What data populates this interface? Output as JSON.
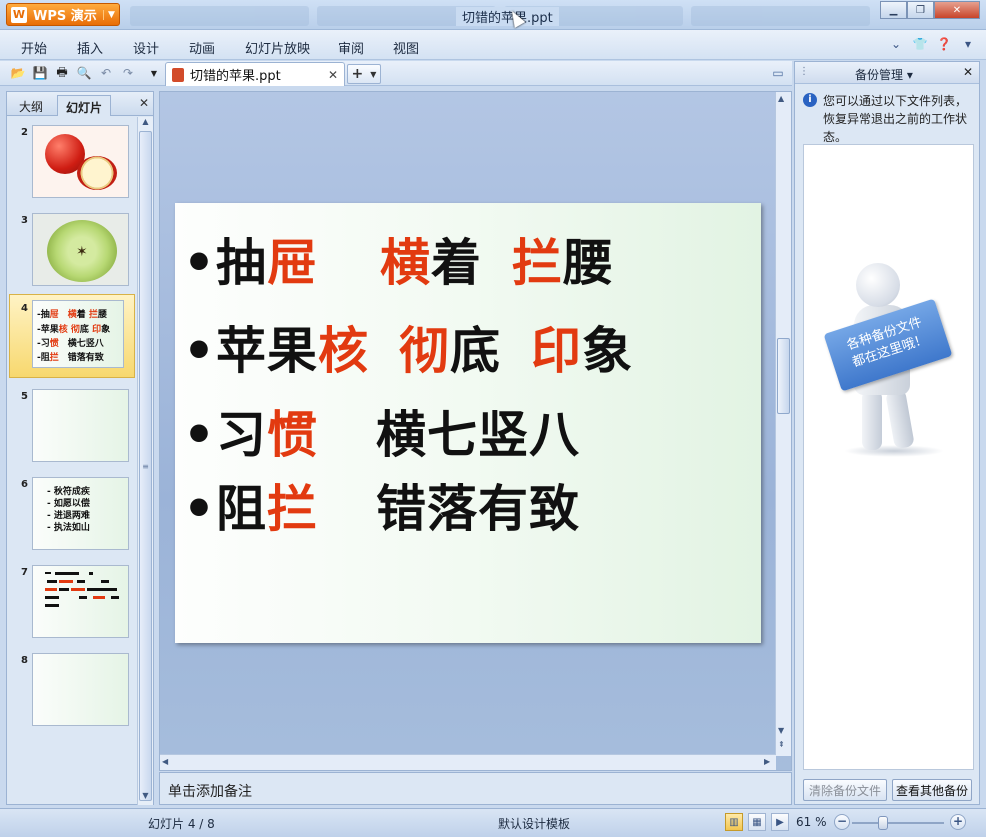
{
  "app": {
    "button_label": "WPS 演示",
    "logo_letter": "W",
    "title": "切错的苹果.ppt"
  },
  "menu": {
    "items": [
      "开始",
      "插入",
      "设计",
      "动画",
      "幻灯片放映",
      "审阅",
      "视图"
    ]
  },
  "toolbar": {
    "doc_tab_label": "切错的苹果.ppt",
    "new_tab_label": "+"
  },
  "left_panel": {
    "tab_outline": "大纲",
    "tab_slides": "幻灯片",
    "thumbnails": [
      {
        "number": "2",
        "kind": "apple-photo"
      },
      {
        "number": "3",
        "kind": "apple-slice"
      },
      {
        "number": "4",
        "kind": "text",
        "selected": true,
        "lines": [
          [
            {
              "t": "-抽",
              "r": false
            },
            {
              "t": "屉",
              "r": true
            },
            {
              "t": "　",
              "r": false
            },
            {
              "t": "横",
              "r": true
            },
            {
              "t": "着 ",
              "r": false
            },
            {
              "t": "拦",
              "r": true
            },
            {
              "t": "腰",
              "r": false
            }
          ],
          [
            {
              "t": "-苹果",
              "r": false
            },
            {
              "t": "核",
              "r": true
            },
            {
              "t": " ",
              "r": false
            },
            {
              "t": "彻",
              "r": true
            },
            {
              "t": "底 ",
              "r": false
            },
            {
              "t": "印",
              "r": true
            },
            {
              "t": "象",
              "r": false
            }
          ],
          [
            {
              "t": "-习",
              "r": false
            },
            {
              "t": "惯",
              "r": true
            },
            {
              "t": "　横七竖八",
              "r": false
            }
          ],
          [
            {
              "t": "-阻",
              "r": false
            },
            {
              "t": "拦",
              "r": true
            },
            {
              "t": "　错落有致",
              "r": false
            }
          ]
        ]
      },
      {
        "number": "5",
        "kind": "blank"
      },
      {
        "number": "6",
        "kind": "text",
        "lines": [
          [
            {
              "t": "- 秋符成疾",
              "r": false
            }
          ],
          [
            {
              "t": "- 如愿以偿",
              "r": false
            }
          ],
          [
            {
              "t": "- 进退两难",
              "r": false
            }
          ],
          [
            {
              "t": "- 执法如山",
              "r": false
            }
          ]
        ]
      },
      {
        "number": "7",
        "kind": "text-small"
      },
      {
        "number": "8",
        "kind": "blank"
      }
    ]
  },
  "slide": {
    "lines": [
      [
        {
          "t": "•抽",
          "r": false
        },
        {
          "t": "屉",
          "r": true
        },
        {
          "t": "GAP1",
          "r": false
        },
        {
          "t": "横",
          "r": true
        },
        {
          "t": "着",
          "r": false
        },
        {
          "t": "GAP2",
          "r": false
        },
        {
          "t": "拦",
          "r": true
        },
        {
          "t": "腰",
          "r": false
        }
      ],
      [
        {
          "t": "•苹果",
          "r": false
        },
        {
          "t": "核",
          "r": true
        },
        {
          "t": "GAP2",
          "r": false
        },
        {
          "t": "彻",
          "r": true
        },
        {
          "t": "底",
          "r": false
        },
        {
          "t": "GAP2",
          "r": false
        },
        {
          "t": "印",
          "r": true
        },
        {
          "t": "象",
          "r": false
        }
      ],
      [
        {
          "t": "•习",
          "r": false
        },
        {
          "t": "惯",
          "r": true
        },
        {
          "t": "GAP3",
          "r": false
        },
        {
          "t": "横七竖八",
          "r": false
        }
      ],
      [
        {
          "t": "•阻",
          "r": false
        },
        {
          "t": "拦",
          "r": true
        },
        {
          "t": "GAP3",
          "r": false
        },
        {
          "t": "错落有致",
          "r": false
        }
      ]
    ]
  },
  "notes": {
    "placeholder": "单击添加备注"
  },
  "right_pane": {
    "title": "备份管理",
    "info": "您可以通过以下文件列表，恢复异常退出之前的工作状态。",
    "sign_line1": "各种备份文件",
    "sign_line2": "都在这里哦！",
    "btn_clear": "清除备份文件",
    "btn_view": "查看其他备份"
  },
  "status": {
    "slide_indicator": "幻灯片 4 / 8",
    "template": "默认设计模板",
    "zoom": "61 %",
    "zoom_level": 0.61
  },
  "colors": {
    "accent_red": "#e23a10",
    "wps_orange": "#f08a1c"
  }
}
